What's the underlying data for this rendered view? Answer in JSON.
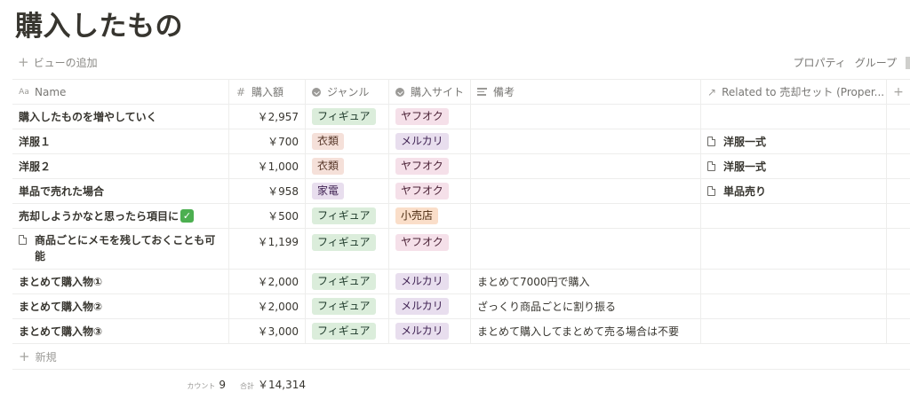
{
  "page": {
    "title": "購入したもの"
  },
  "toolbar": {
    "add_view": "ビューの追加",
    "properties": "プロパティ",
    "group": "グループ"
  },
  "columns": {
    "name": "Name",
    "amount": "購入額",
    "genre": "ジャンル",
    "site": "購入サイト",
    "memo": "備考",
    "related": "Related to 売却セット (Proper..."
  },
  "tag_colors": {
    "フィギュア": {
      "bg": "#dbeddb",
      "fg": "#1c3829"
    },
    "衣類": {
      "bg": "#f5e0d9",
      "fg": "#5a3a2c"
    },
    "家電": {
      "bg": "#e8deee",
      "fg": "#412454"
    },
    "ヤフオク": {
      "bg": "#f5e0e9",
      "fg": "#4c2337"
    },
    "メルカリ": {
      "bg": "#e8deee",
      "fg": "#412454"
    },
    "小売店": {
      "bg": "#fadec9",
      "fg": "#49290e"
    }
  },
  "rows": [
    {
      "name": "購入したものを増やしていく",
      "amount": "￥2,957",
      "genre": "フィギュア",
      "site": "ヤフオク",
      "memo": "",
      "related": ""
    },
    {
      "name": "洋服１",
      "amount": "￥700",
      "genre": "衣類",
      "site": "メルカリ",
      "memo": "",
      "related": "洋服一式"
    },
    {
      "name": "洋服２",
      "amount": "￥1,000",
      "genre": "衣類",
      "site": "ヤフオク",
      "memo": "",
      "related": "洋服一式"
    },
    {
      "name": "単品で売れた場合",
      "amount": "￥958",
      "genre": "家電",
      "site": "ヤフオク",
      "memo": "",
      "related": "単品売り"
    },
    {
      "name": "売却しようかなと思ったら項目に",
      "check": "✓",
      "amount": "￥500",
      "genre": "フィギュア",
      "site": "小売店",
      "memo": "",
      "related": ""
    },
    {
      "name": "商品ごとにメモを残しておくことも可能",
      "page_icon": "page-icon",
      "amount": "￥1,199",
      "genre": "フィギュア",
      "site": "ヤフオク",
      "memo": "",
      "related": ""
    },
    {
      "name": "まとめて購入物①",
      "amount": "￥2,000",
      "genre": "フィギュア",
      "site": "メルカリ",
      "memo": "まとめて7000円で購入",
      "related": ""
    },
    {
      "name": "まとめて購入物②",
      "amount": "￥2,000",
      "genre": "フィギュア",
      "site": "メルカリ",
      "memo": "ざっくり商品ごとに割り振る",
      "related": ""
    },
    {
      "name": "まとめて購入物③",
      "amount": "￥3,000",
      "genre": "フィギュア",
      "site": "メルカリ",
      "memo": "まとめて購入してまとめて売る場合は不要",
      "related": ""
    }
  ],
  "new_row": {
    "label": "新規"
  },
  "footer": {
    "count_label": "カウント",
    "count_value": "9",
    "sum_label": "合計",
    "sum_value": "￥14,314"
  }
}
